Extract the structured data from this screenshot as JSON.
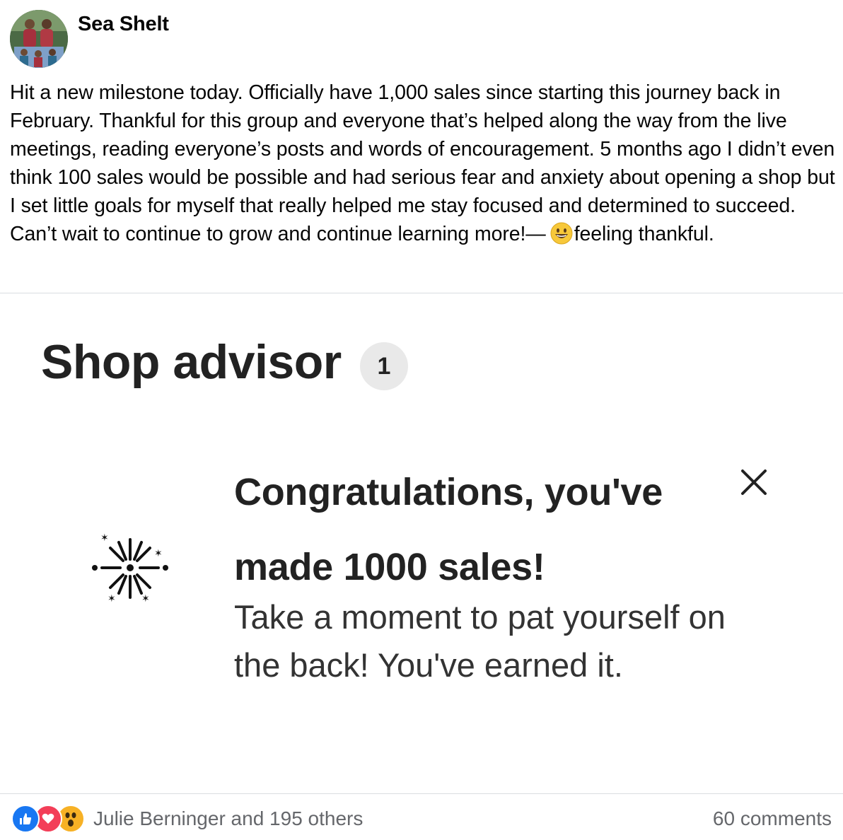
{
  "post": {
    "author": "Sea Shelt",
    "body_text": "Hit a new milestone today. Officially have 1,000 sales since starting this journey back in February. Thankful for this group and everyone that’s helped along the way from the live meetings, reading everyone’s posts and words of encouragement. 5 months ago I didn’t even think 100 sales would be possible and had serious fear and anxiety about opening a shop but I set little goals for myself that really helped me stay focused and determined to succeed. Can’t wait to continue to grow and continue learning more!—",
    "feeling_emoji": "grinning-face-icon",
    "feeling_text": "feeling thankful."
  },
  "screenshot": {
    "shop_title": "Shop advisor",
    "badge_count": "1",
    "congrats_title": "Congratulations, you've made 1000 sales!",
    "congrats_body": "Take a moment to pat yourself on the back! You've earned it.",
    "icon": "fireworks-icon"
  },
  "footer": {
    "reaction_icons": [
      "like-icon",
      "love-icon",
      "wow-icon"
    ],
    "reactors_text": "Julie Berninger and 195 others",
    "comments_text": "60 comments"
  },
  "colors": {
    "like": "#1877f2",
    "love": "#f33e58",
    "wow": "#f7b125",
    "secondary_text": "#65676b"
  }
}
